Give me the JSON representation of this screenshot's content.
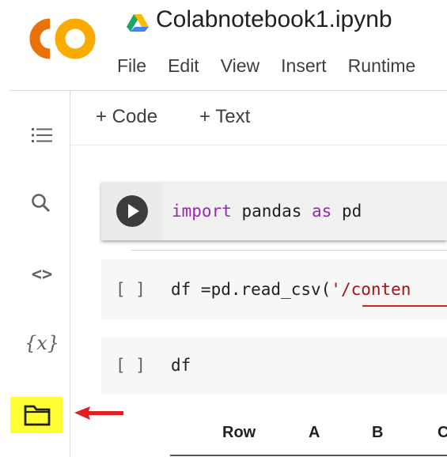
{
  "header": {
    "logo_text": "CO",
    "notebook_title": "Colabnotebook1.ipynb",
    "drive_icon": "google-drive-icon"
  },
  "menu": {
    "items": [
      "File",
      "Edit",
      "View",
      "Insert",
      "Runtime"
    ]
  },
  "sidebar": {
    "icons": [
      "table-of-contents-icon",
      "search-icon",
      "code-snippets-icon",
      "variables-icon",
      "files-folder-icon"
    ],
    "variables_label": "{x}",
    "code_label": "<>"
  },
  "toolbar": {
    "add_code": "+ Code",
    "add_text": "+ Text"
  },
  "cells": [
    {
      "status": "run",
      "code": {
        "kw1": "import",
        "mid": " pandas ",
        "kw2": "as",
        "end": " pd"
      }
    },
    {
      "status": "[ ]",
      "code": {
        "pre": "df =pd.read_csv(",
        "str": "'/conten"
      }
    },
    {
      "status": "[ ]",
      "code": {
        "pre": "df"
      }
    }
  ],
  "output_table": {
    "headers": [
      "Row",
      "A",
      "B",
      "C"
    ]
  },
  "annotations": {
    "highlight_color": "#ffff33",
    "arrow_color": "#e02020"
  },
  "colors": {
    "logo_orange": "#f9ab00",
    "logo_dark_orange": "#e8710a",
    "keyword": "#9c27b0",
    "string": "#a31515"
  }
}
